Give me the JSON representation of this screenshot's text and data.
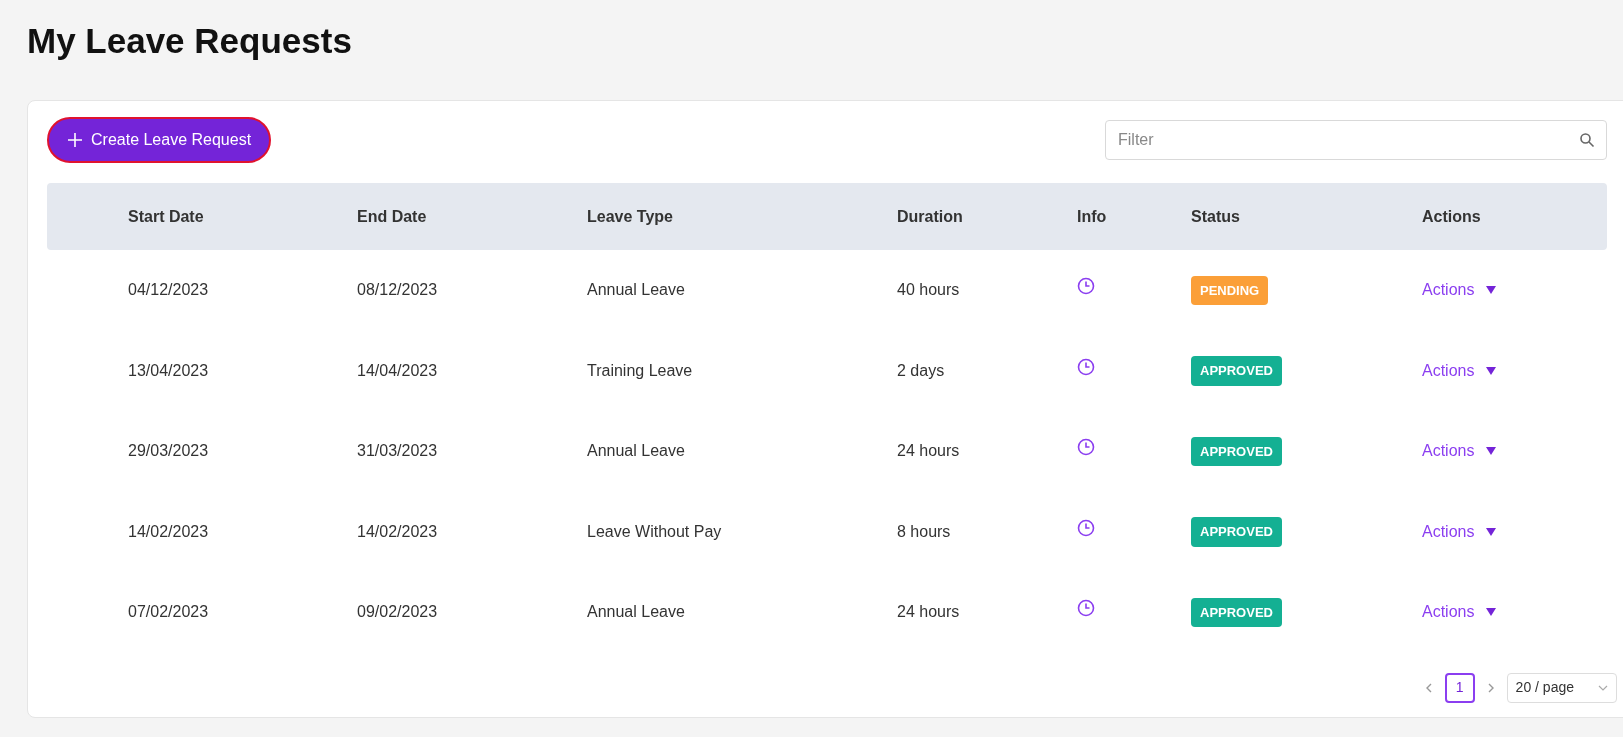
{
  "title": "My Leave Requests",
  "create_button": {
    "label": "Create Leave Request"
  },
  "filter": {
    "placeholder": "Filter"
  },
  "table": {
    "columns": [
      "Start Date",
      "End Date",
      "Leave Type",
      "Duration",
      "Info",
      "Status",
      "Actions"
    ],
    "rows": [
      {
        "start": "04/12/2023",
        "end": "08/12/2023",
        "type": "Annual Leave",
        "duration": "40 hours",
        "status": {
          "label": "PENDING",
          "kind": "pending"
        },
        "action": "Actions"
      },
      {
        "start": "13/04/2023",
        "end": "14/04/2023",
        "type": "Training Leave",
        "duration": "2 days",
        "status": {
          "label": "APPROVED",
          "kind": "approved"
        },
        "action": "Actions"
      },
      {
        "start": "29/03/2023",
        "end": "31/03/2023",
        "type": "Annual Leave",
        "duration": "24 hours",
        "status": {
          "label": "APPROVED",
          "kind": "approved"
        },
        "action": "Actions"
      },
      {
        "start": "14/02/2023",
        "end": "14/02/2023",
        "type": "Leave Without Pay",
        "duration": "8 hours",
        "status": {
          "label": "APPROVED",
          "kind": "approved"
        },
        "action": "Actions"
      },
      {
        "start": "07/02/2023",
        "end": "09/02/2023",
        "type": "Annual Leave",
        "duration": "24 hours",
        "status": {
          "label": "APPROVED",
          "kind": "approved"
        },
        "action": "Actions"
      }
    ]
  },
  "pagination": {
    "pages": [
      {
        "label": "1",
        "selected": true
      }
    ],
    "page_size": "20 / page"
  }
}
